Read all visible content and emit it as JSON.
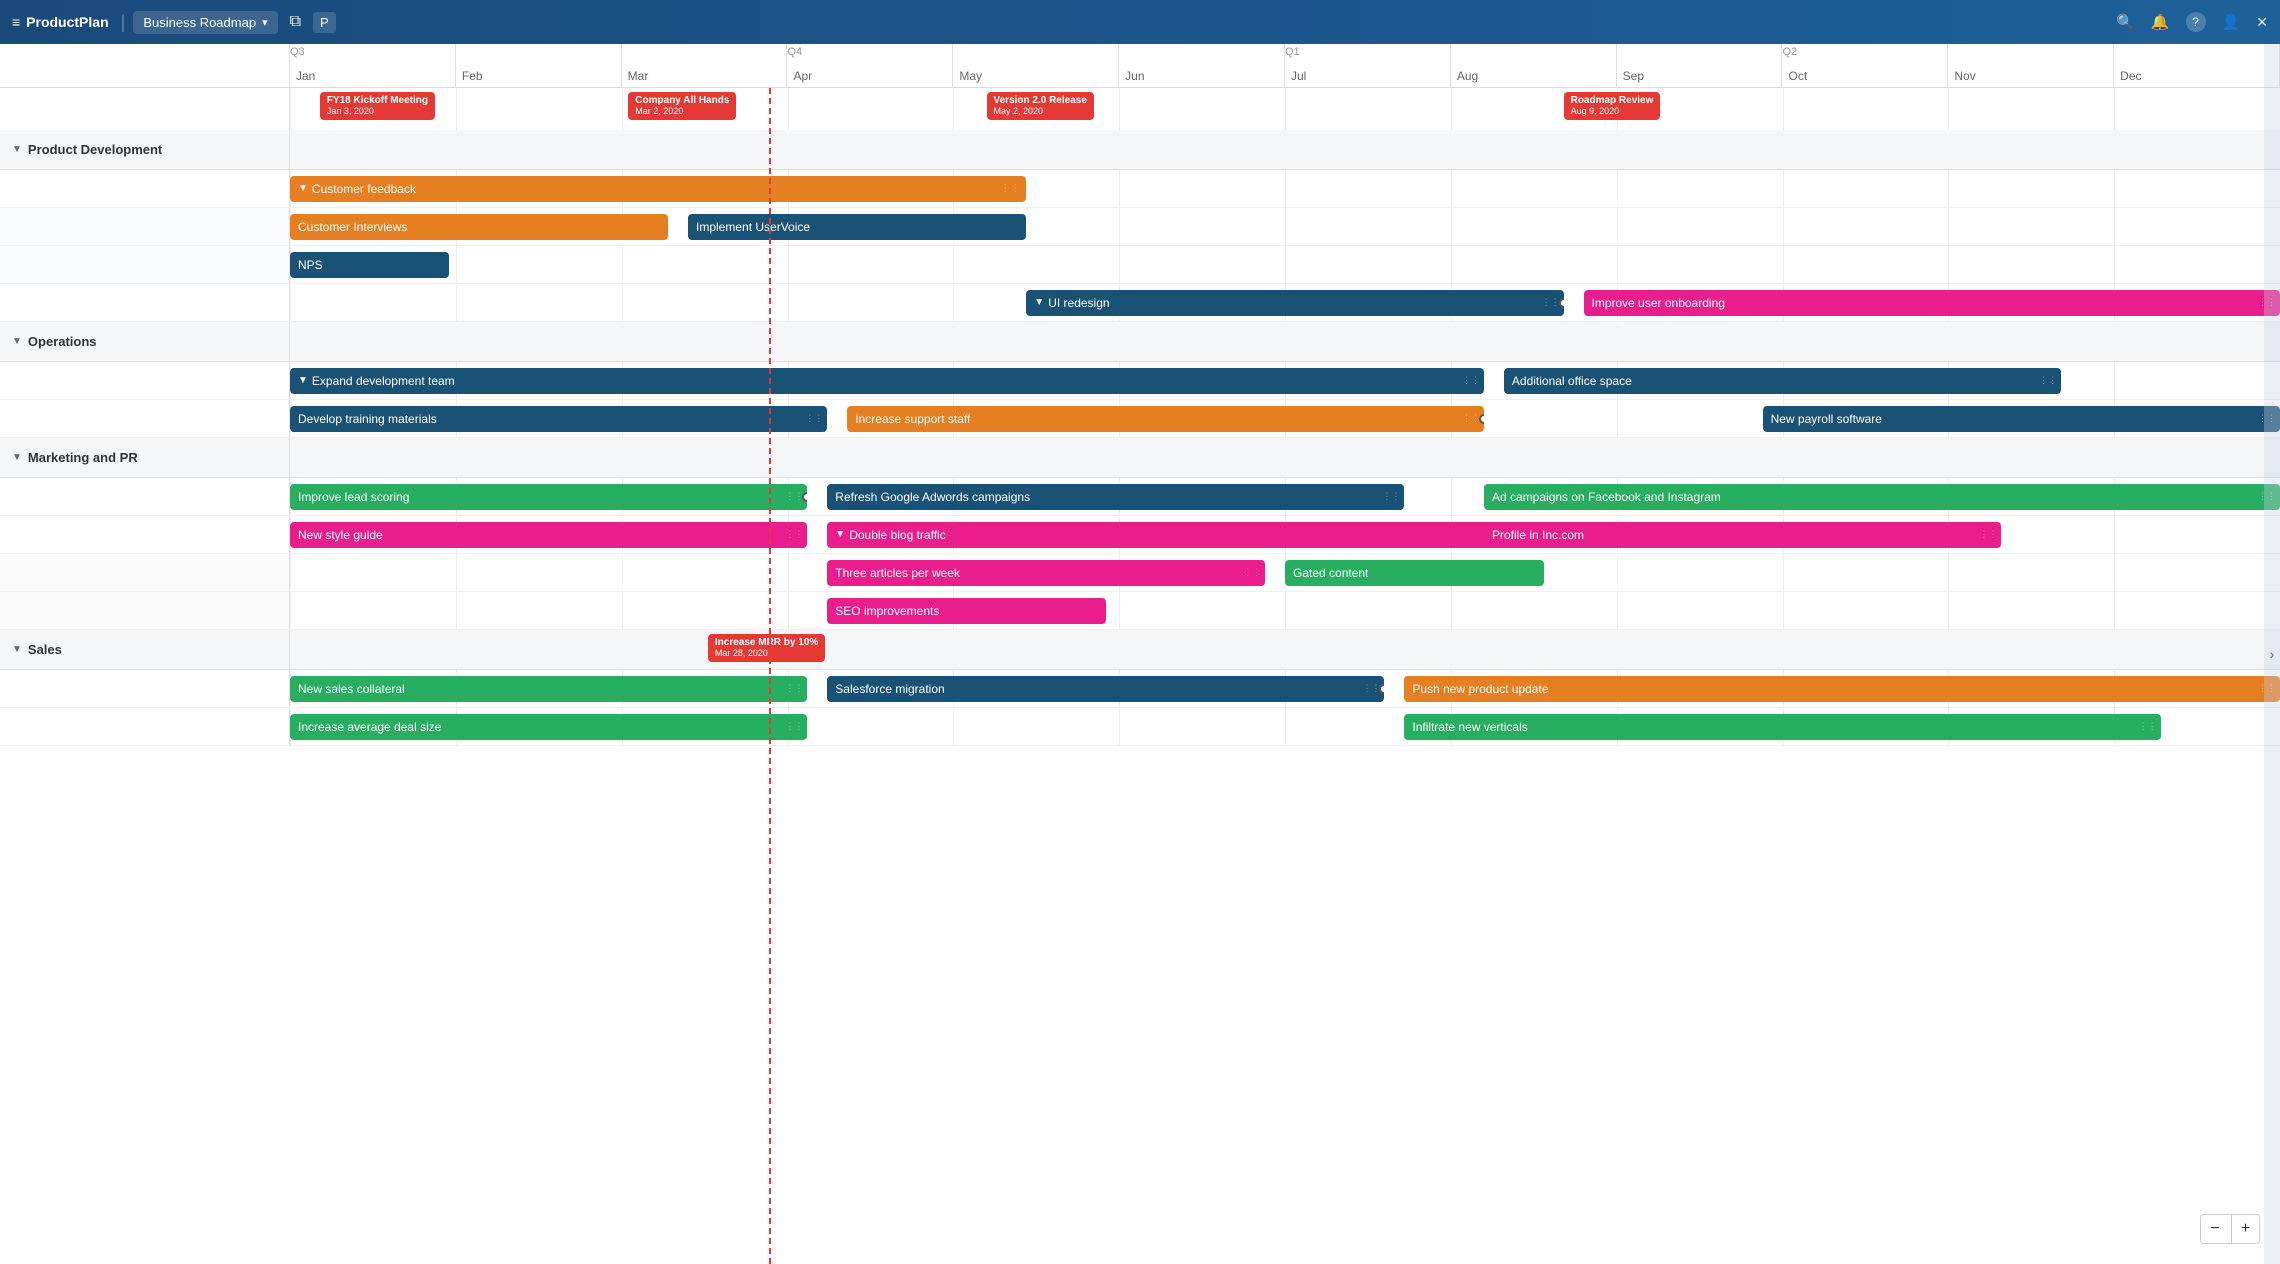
{
  "app": {
    "name": "ProductPlan",
    "title": "Business Roadmap"
  },
  "nav": {
    "logo_icon": "≡",
    "title": "ProductPlan",
    "breadcrumb": "Business Roadmap",
    "dropdown_icon": "▾",
    "copy_icon": "⧉",
    "share_icon": "P",
    "search_icon": "🔍",
    "bell_icon": "🔔",
    "help_icon": "?",
    "user_icon": "👤",
    "close_icon": "✕"
  },
  "timeline": {
    "months": [
      "Jan",
      "Feb",
      "Mar",
      "Apr",
      "May",
      "Jun",
      "Jul",
      "Aug",
      "Sep",
      "Oct",
      "Nov",
      "Dec"
    ],
    "quarters": [
      {
        "label": "Q3",
        "col_start": 0
      },
      {
        "label": "Q4",
        "col_start": 3
      },
      {
        "label": "Q1",
        "col_start": 6
      },
      {
        "label": "Q2",
        "col_start": 9
      }
    ]
  },
  "milestones": [
    {
      "label": "FY18 Kickoff Meeting",
      "date": "Jan 3, 2020",
      "left_pct": 2
    },
    {
      "label": "Company All Hands",
      "date": "Mar 2, 2020",
      "left_pct": 18
    },
    {
      "label": "Version 2.0 Release",
      "date": "May 2, 2020",
      "left_pct": 37
    },
    {
      "label": "Roadmap Review",
      "date": "Aug 9, 2020",
      "left_pct": 66
    },
    {
      "label": "Increase MRR by 10%",
      "date": "Mar 28, 2020",
      "left_pct": 21
    }
  ],
  "sections": [
    {
      "id": "product",
      "label": "Product Development",
      "expanded": true,
      "rows": [
        {
          "id": "customer-feedback",
          "label": "Customer feedback",
          "color": "orange",
          "bar": {
            "left_pct": 0,
            "width_pct": 37,
            "label": "Customer feedback",
            "has_chevron": true
          },
          "sub_rows": [
            {
              "bars": [
                {
                  "left_pct": 0,
                  "width_pct": 19,
                  "label": "Customer Interviews",
                  "color": "orange"
                },
                {
                  "left_pct": 20,
                  "width_pct": 17,
                  "label": "Implement UserVoice",
                  "color": "blue"
                }
              ]
            },
            {
              "bars": [
                {
                  "left_pct": 0,
                  "width_pct": 8,
                  "label": "NPS",
                  "color": "blue"
                }
              ]
            }
          ]
        },
        {
          "id": "ui-redesign",
          "label": "",
          "bars": [
            {
              "left_pct": 37,
              "width_pct": 27,
              "label": "UI redesign",
              "color": "blue",
              "has_chevron": true,
              "has_diamond": true
            },
            {
              "left_pct": 65,
              "width_pct": 35,
              "label": "Improve user onboarding",
              "color": "pink"
            }
          ]
        }
      ]
    },
    {
      "id": "operations",
      "label": "Operations",
      "expanded": true,
      "rows": [
        {
          "id": "expand-dev",
          "bars": [
            {
              "left_pct": 0,
              "width_pct": 60,
              "label": "Expand development team",
              "color": "blue",
              "has_chevron": true
            },
            {
              "left_pct": 61,
              "width_pct": 28,
              "label": "Additional office space",
              "color": "blue"
            }
          ]
        },
        {
          "id": "training",
          "bars": [
            {
              "left_pct": 0,
              "width_pct": 27,
              "label": "Develop training materials",
              "color": "blue"
            },
            {
              "left_pct": 28,
              "width_pct": 32,
              "label": "Increase support staff",
              "color": "orange",
              "has_diamond": true
            },
            {
              "left_pct": 74,
              "width_pct": 26,
              "label": "New payroll software",
              "color": "blue"
            }
          ]
        }
      ]
    },
    {
      "id": "marketing",
      "label": "Marketing and PR",
      "expanded": true,
      "rows": [
        {
          "id": "lead-scoring",
          "bars": [
            {
              "left_pct": 0,
              "width_pct": 26,
              "label": "Improve lead scoring",
              "color": "green",
              "has_diamond": true
            },
            {
              "left_pct": 27,
              "width_pct": 29,
              "label": "Refresh Google Adwords campaigns",
              "color": "blue"
            },
            {
              "left_pct": 60,
              "width_pct": 40,
              "label": "Ad campaigns on Facebook and Instagram",
              "color": "green"
            }
          ]
        },
        {
          "id": "style-guide",
          "bars": [
            {
              "left_pct": 0,
              "width_pct": 26,
              "label": "New style guide",
              "color": "pink"
            },
            {
              "left_pct": 27,
              "width_pct": 46,
              "label": "Double blog traffic",
              "color": "pink",
              "has_chevron": true,
              "expanded": true
            },
            {
              "left_pct": 60,
              "width_pct": 26,
              "label": "Profile in Inc.com",
              "color": "pink"
            }
          ]
        },
        {
          "id": "blog-sub",
          "sub": true,
          "bars": [
            {
              "left_pct": 27,
              "width_pct": 22,
              "label": "Three articles per week",
              "color": "pink"
            },
            {
              "left_pct": 50,
              "width_pct": 13,
              "label": "Gated content",
              "color": "green"
            }
          ]
        },
        {
          "id": "seo",
          "sub": true,
          "bars": [
            {
              "left_pct": 27,
              "width_pct": 14,
              "label": "SEO improvements",
              "color": "pink"
            }
          ]
        }
      ]
    },
    {
      "id": "sales",
      "label": "Sales",
      "expanded": true,
      "rows": [
        {
          "id": "new-sales-collateral",
          "bars": [
            {
              "left_pct": 0,
              "width_pct": 26,
              "label": "New sales collateral",
              "color": "green"
            },
            {
              "left_pct": 27,
              "width_pct": 28,
              "label": "Salesforce migration",
              "color": "blue",
              "has_diamond": true
            },
            {
              "left_pct": 56,
              "width_pct": 44,
              "label": "Push new product update",
              "color": "orange"
            }
          ]
        },
        {
          "id": "avg-deal",
          "bars": [
            {
              "left_pct": 0,
              "width_pct": 26,
              "label": "Increase average deal size",
              "color": "green"
            },
            {
              "left_pct": 56,
              "width_pct": 38,
              "label": "Infiltrate new verticals",
              "color": "green"
            }
          ]
        }
      ]
    }
  ],
  "zoom": {
    "minus": "−",
    "plus": "+"
  }
}
